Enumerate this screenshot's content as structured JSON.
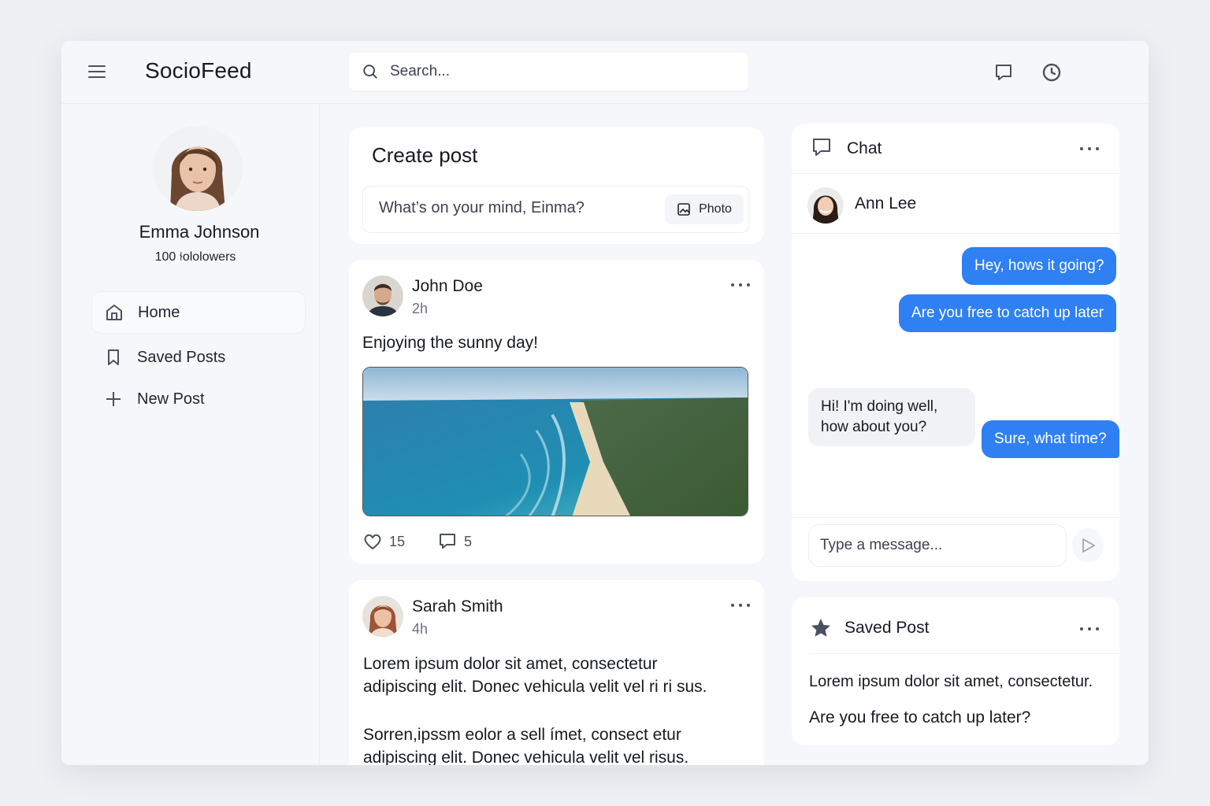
{
  "app": {
    "brand": "SocioFeed"
  },
  "search": {
    "placeholder": "Search..."
  },
  "profile": {
    "name": "Emma Johnson",
    "followers": "100 ⫮ololowers"
  },
  "nav": {
    "items": [
      {
        "label": "Home",
        "icon": "home-icon"
      },
      {
        "label": "Saved Posts",
        "icon": "bookmark-icon"
      },
      {
        "label": "New Post",
        "icon": "plus-icon"
      }
    ]
  },
  "create_post": {
    "title": "Create post",
    "placeholder": "What’s on your  mind, Einma?",
    "photo_label": "Photo"
  },
  "posts": [
    {
      "author": "John Doe",
      "time": "2h",
      "text": "Enjoying the sunny day!",
      "likes": "15",
      "comments": "5"
    },
    {
      "author": "Sarah Smith",
      "time": "4h",
      "paragraphs": [
        "Lorem ipsum dolor sit amet, consectetur adipiscing elit. Donec vehicula velit vel ri ri sus.",
        "Sorren,ipssm eolor a sell ímet, consect etur adipiscing elit. Donec vehicula velit vel risus."
      ]
    }
  ],
  "chat": {
    "title": "Chat",
    "contact": "Ann Lee",
    "messages": [
      {
        "from": "me",
        "text": "Hey, hows it going?"
      },
      {
        "from": "me",
        "text": "Are you free to catch up later"
      },
      {
        "from": "them",
        "text": "Hi! I'm doing well, how about you?"
      },
      {
        "from": "me",
        "text": "Sure, what time?"
      }
    ],
    "input_placeholder": "Type a message..."
  },
  "saved_post": {
    "title": "Saved Post",
    "text": "Lorem ipsum dolor sit amet, consectetur.",
    "highlight": "Are you free to catch up later?"
  },
  "colors": {
    "accent": "#2f80f2",
    "background": "#eef0f4",
    "panel": "#f6f7fa",
    "card": "#ffffff"
  }
}
